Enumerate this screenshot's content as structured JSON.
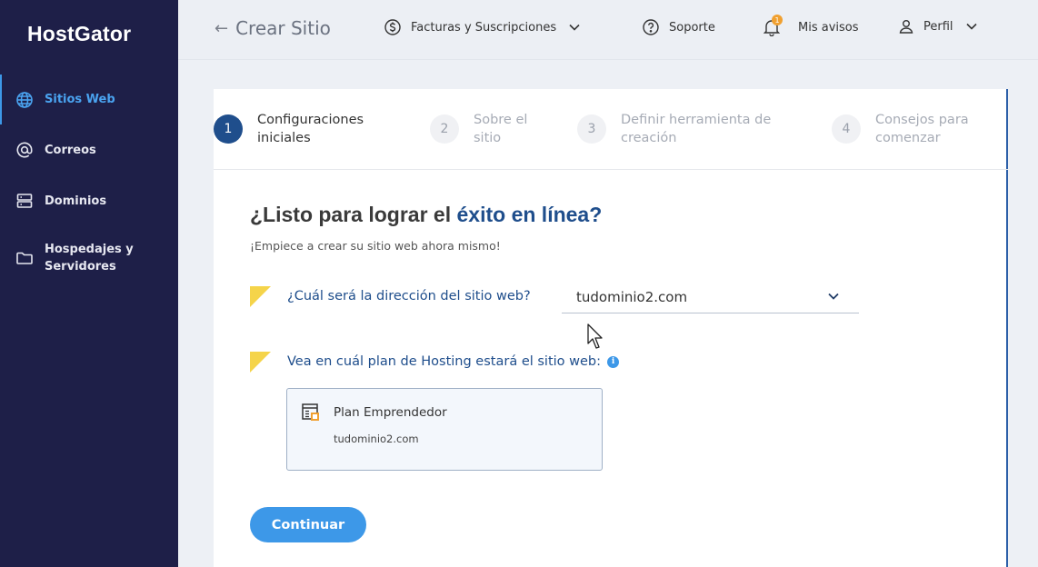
{
  "brand": {
    "logo_text": "HostGator"
  },
  "sidebar": {
    "items": [
      {
        "label": "Sitios Web",
        "icon": "globe-icon",
        "active": true
      },
      {
        "label": "Correos",
        "icon": "at-icon"
      },
      {
        "label": "Dominios",
        "icon": "server-icon"
      },
      {
        "label": "Hospedajes y Servidores",
        "icon": "folder-icon"
      }
    ]
  },
  "topbar": {
    "back_label": "Crear Sitio",
    "billing_label": "Facturas y Suscripciones",
    "support_label": "Soporte",
    "notices_label": "Mis avisos",
    "notices_count": "1",
    "profile_label": "Perfil"
  },
  "steps": [
    {
      "number": "1",
      "label": "Configuraciones iniciales",
      "active": true
    },
    {
      "number": "2",
      "label": "Sobre el sitio"
    },
    {
      "number": "3",
      "label": "Definir herramienta de creación"
    },
    {
      "number": "4",
      "label": "Consejos para comenzar"
    }
  ],
  "main": {
    "heading_prefix": "¿Listo para lograr el ",
    "heading_highlight": "éxito en línea?",
    "subheading": "¡Empiece a crear su sitio web ahora mismo!",
    "question_domain": "¿Cuál será la dirección del sitio web?",
    "domain_selected": "tudominio2.com",
    "question_plan": "Vea en cuál plan de Hosting estará el sitio web:",
    "info_glyph": "i",
    "plan_name": "Plan Emprendedor",
    "plan_domain": "tudominio2.com",
    "continue_label": "Continuar"
  },
  "colors": {
    "sidebar_bg": "#1e1f48",
    "accent_blue": "#3d98e8",
    "heading_blue": "#1f4e8c",
    "flag_yellow": "#f5d44a",
    "badge_orange": "#f0a030"
  }
}
